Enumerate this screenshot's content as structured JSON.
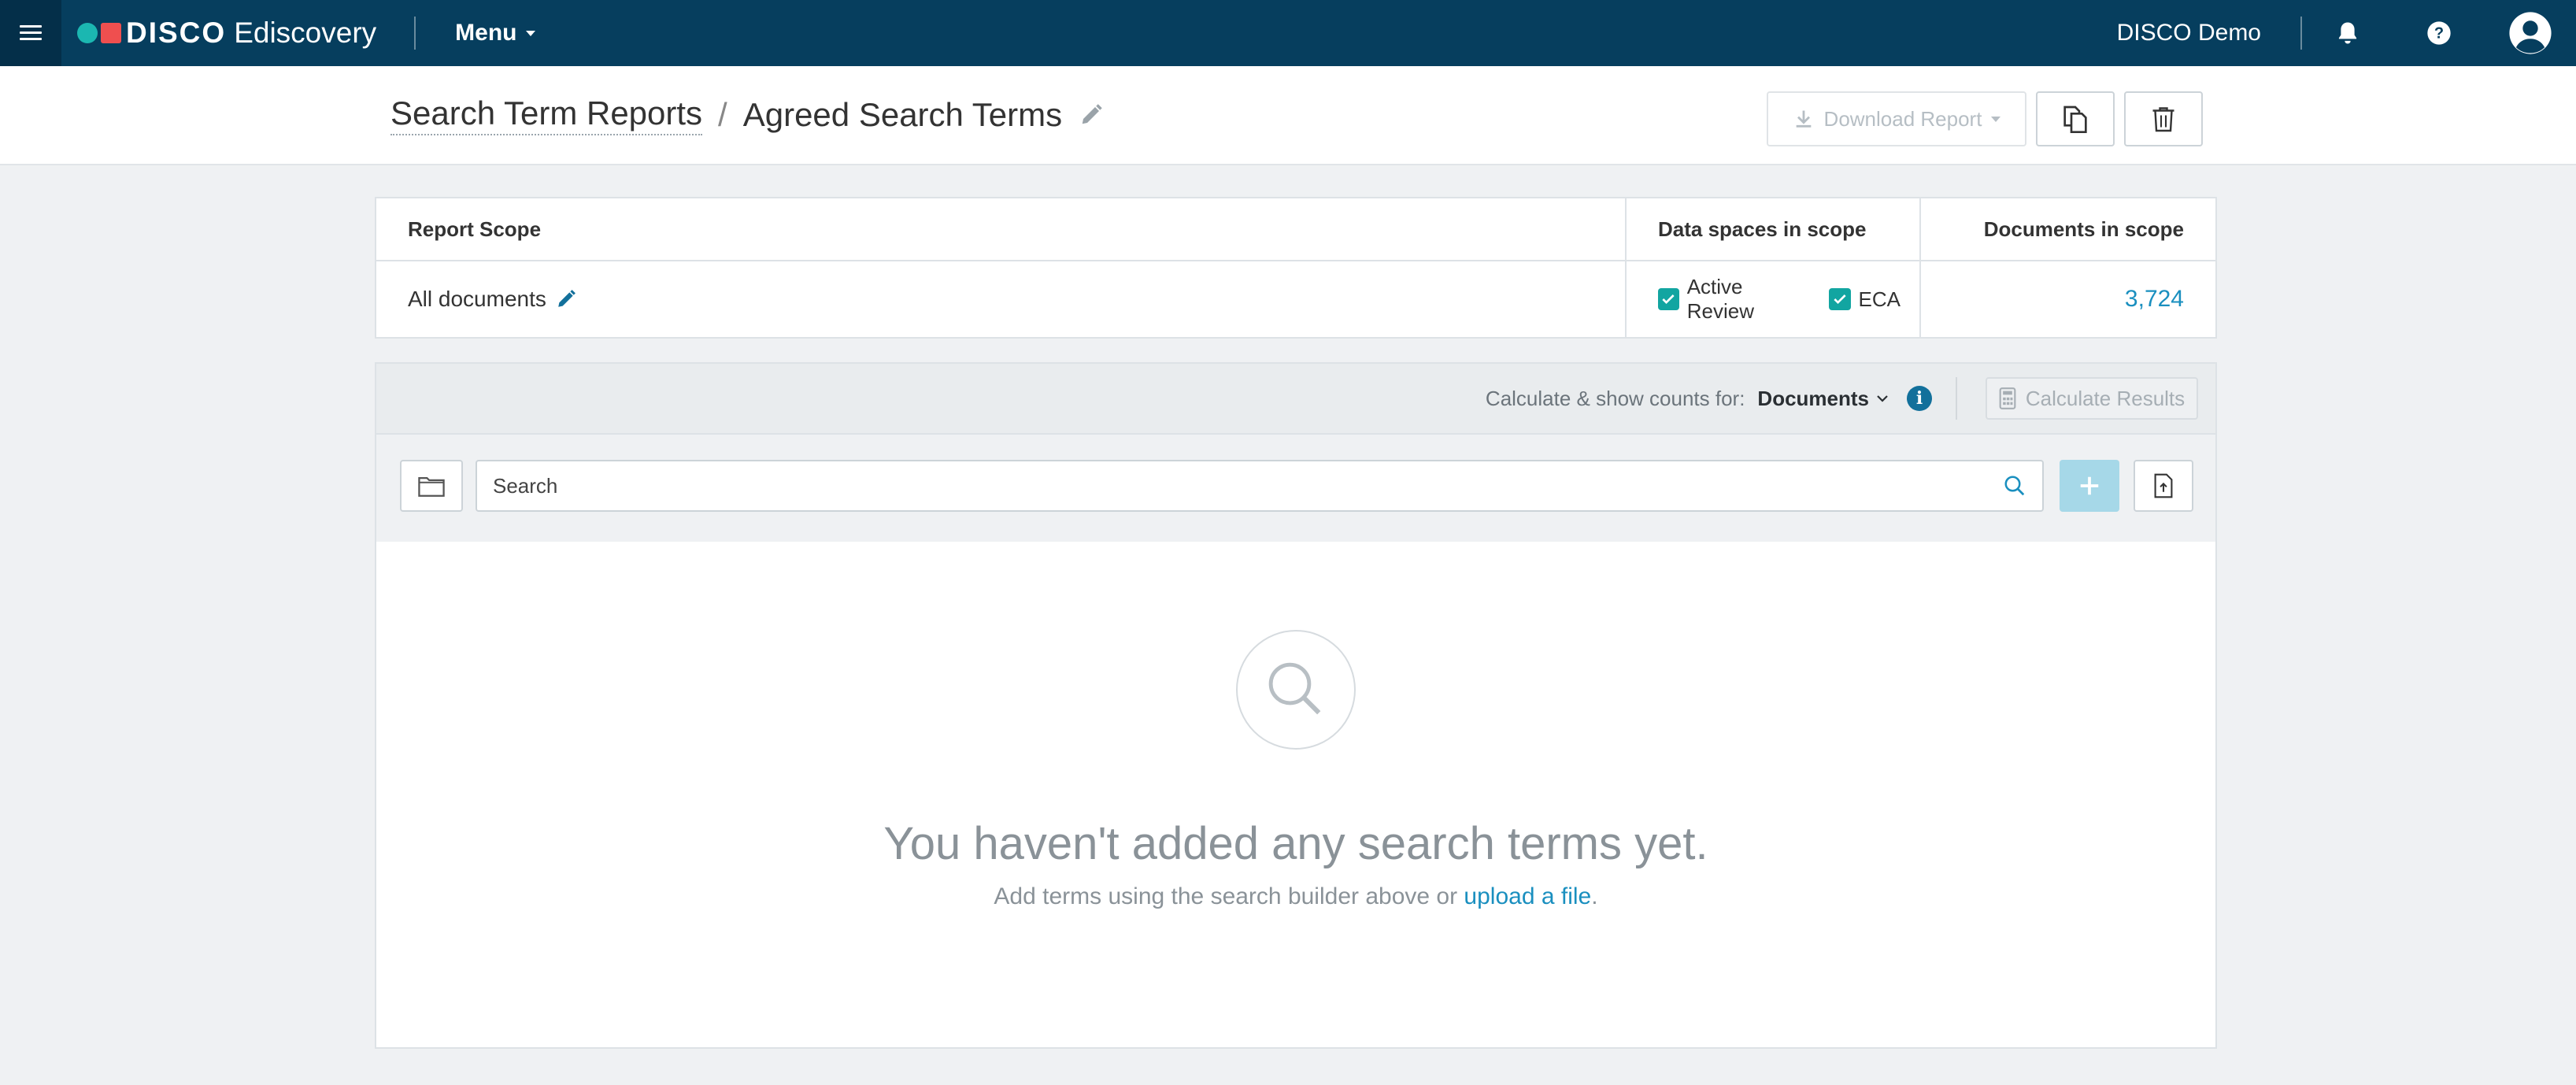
{
  "topbar": {
    "menu_icon": "hamburger-icon",
    "brand": "DISCO",
    "product": "Ediscovery",
    "menu_label": "Menu",
    "org_name": "DISCO Demo",
    "icons": [
      "bell-icon",
      "help-icon",
      "user-avatar-icon"
    ]
  },
  "header": {
    "breadcrumb_parent": "Search Term Reports",
    "separator": "/",
    "title": "Agreed Search Terms",
    "download_label": "Download Report"
  },
  "scope": {
    "col_scope": "Report Scope",
    "col_spaces": "Data spaces in scope",
    "col_docs": "Documents in scope",
    "scope_value": "All documents",
    "spaces": [
      {
        "label": "Active Review",
        "checked": true
      },
      {
        "label": "ECA",
        "checked": true
      }
    ],
    "doc_count": "3,724"
  },
  "calc": {
    "label": "Calculate & show counts for:",
    "selected": "Documents",
    "button": "Calculate Results"
  },
  "search": {
    "placeholder": "Search"
  },
  "empty": {
    "title": "You haven't added any search terms yet.",
    "sub_before": "Add terms using the search builder above or ",
    "sub_link": "upload a file",
    "sub_after": "."
  },
  "colors": {
    "navbar": "#063e5e",
    "teal": "#12a5a1",
    "link": "#1a8fbf",
    "logo_red": "#ef4f4f"
  }
}
